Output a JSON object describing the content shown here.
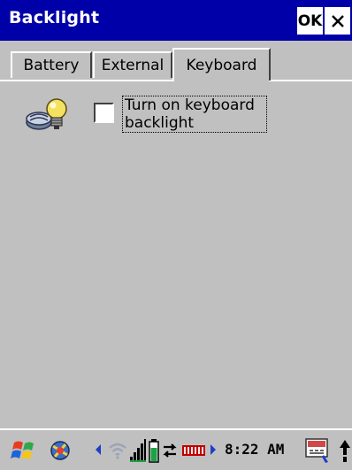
{
  "window": {
    "title": "Backlight",
    "ok_label": "OK"
  },
  "tabs": [
    {
      "label": "Battery",
      "selected": false
    },
    {
      "label": "External",
      "selected": false
    },
    {
      "label": "Keyboard",
      "selected": true
    }
  ],
  "keyboard_tab": {
    "icon": "lightbulb-icon",
    "checkbox_label": "Turn on keyboard backlight",
    "checked": false
  },
  "taskbar": {
    "clock": "8:22 AM",
    "icons": [
      "start-flag-icon",
      "app-icon",
      "scroll-left-icon",
      "wifi-icon",
      "signal-strength-icon",
      "battery-level-icon",
      "sync-icon",
      "keyboard-status-icon",
      "scroll-right-icon",
      "input-panel-icon",
      "up-arrow-icon"
    ]
  },
  "colors": {
    "titlebar": "#0000a8",
    "background": "#c0c0c0"
  }
}
